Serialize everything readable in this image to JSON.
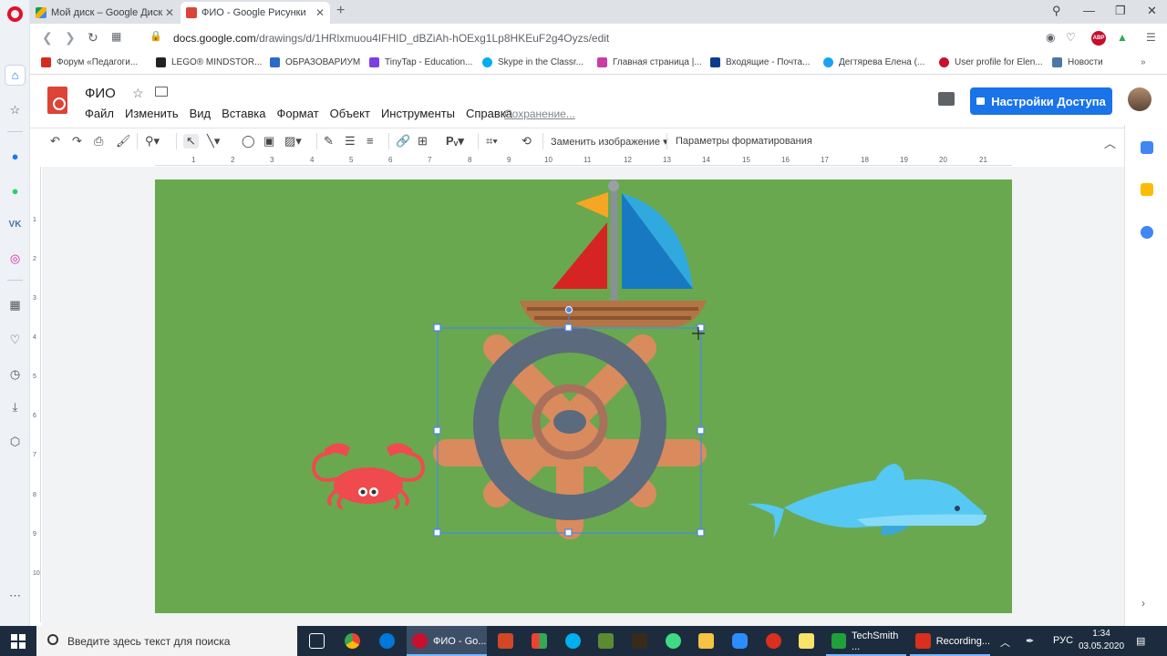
{
  "browser": {
    "tabs": [
      {
        "title": "Мой диск – Google Диск",
        "favicon": "google-drive-icon"
      },
      {
        "title": "ФИО - Google Рисунки",
        "favicon": "google-drawings-icon"
      }
    ],
    "url_host": "docs.google.com",
    "url_path": "/drawings/d/1HRlxmuou4IFHID_dBZiAh-hOExg1Lp8HKEuF2g4Oyzs/edit",
    "abp_label": "ABP",
    "bookmarks": [
      {
        "label": "Форум «Педагоги...",
        "color": "#d52b1e"
      },
      {
        "label": "LEGO® MINDSTOR...",
        "color": "#222222"
      },
      {
        "label": "ОБРАЗОВАРИУМ",
        "color": "#2a6ac8"
      },
      {
        "label": "TinyTap - Education...",
        "color": "#7b3fe4"
      },
      {
        "label": "Skype in the Classr...",
        "color": "#00aff0"
      },
      {
        "label": "Главная страница |...",
        "color": "#c93ea4"
      },
      {
        "label": "Входящие - Почта...",
        "color": "#0a3e8c"
      },
      {
        "label": "Дегтярева Елена (...",
        "color": "#1da1f2"
      },
      {
        "label": "User profile for Elen...",
        "color": "#c8102e"
      },
      {
        "label": "Новости",
        "color": "#4a76a8"
      }
    ]
  },
  "app": {
    "title": "ФИО",
    "menu": [
      "Файл",
      "Изменить",
      "Вид",
      "Вставка",
      "Формат",
      "Объект",
      "Инструменты",
      "Справка"
    ],
    "saving_status": "Сохранение...",
    "share_button": "Настройки Доступа",
    "toolbar": {
      "replace_image": "Заменить изображение",
      "format_options": "Параметры форматирования"
    },
    "ruler_ticks": [
      "1",
      "2",
      "3",
      "4",
      "5",
      "6",
      "7",
      "8",
      "9",
      "10",
      "11",
      "12",
      "13",
      "14",
      "15",
      "16",
      "17",
      "18",
      "19",
      "20",
      "21"
    ],
    "vruler_ticks": [
      "1",
      "2",
      "3",
      "4",
      "5",
      "6",
      "7",
      "8",
      "9",
      "10"
    ]
  },
  "canvas": {
    "background": "#69a84f",
    "objects": [
      "sailboat",
      "ship-wheel",
      "crab",
      "dolphin"
    ]
  },
  "taskbar": {
    "search_placeholder": "Введите здесь текст для поиска",
    "apps": [
      {
        "label": "ФИО - Go...",
        "active": true,
        "color": "#c7102e"
      },
      {
        "label": "TechSmith ...",
        "active": false,
        "color": "#1fa03b"
      },
      {
        "label": "Recording...",
        "active": false,
        "color": "#d9301e"
      }
    ],
    "language": "РУС",
    "time": "1:34",
    "date": "03.05.2020"
  }
}
